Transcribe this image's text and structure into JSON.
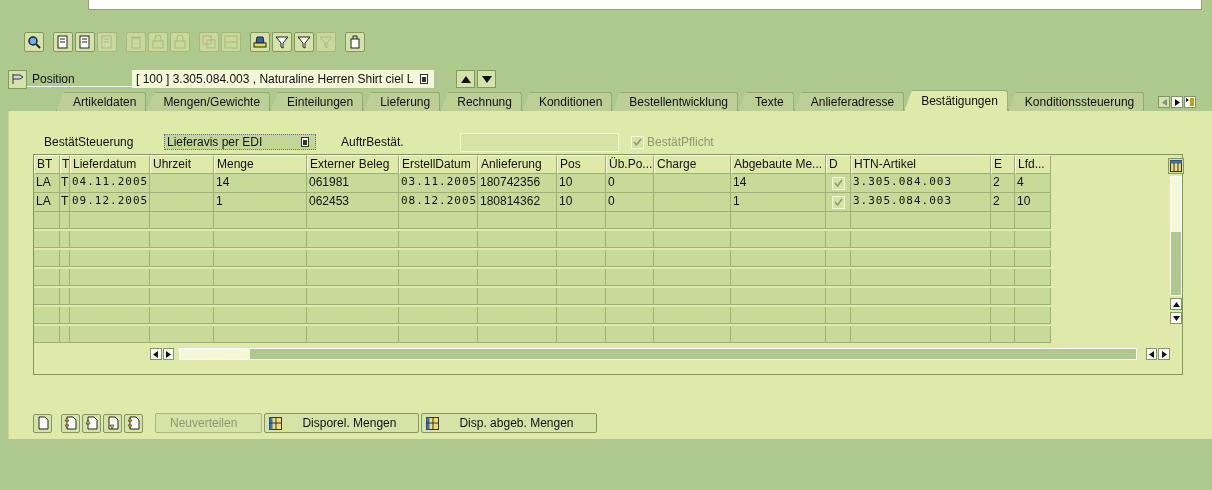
{
  "toolbar": [
    {
      "kind": "search",
      "disabled": false
    },
    {
      "kind": "doc",
      "disabled": false
    },
    {
      "kind": "doc",
      "disabled": false
    },
    {
      "kind": "doc",
      "disabled": true
    },
    {
      "kind": "trash",
      "disabled": true
    },
    {
      "kind": "lock",
      "disabled": true
    },
    {
      "kind": "lock",
      "disabled": true
    },
    {
      "kind": "copy",
      "disabled": true
    },
    {
      "kind": "grid",
      "disabled": true
    },
    {
      "kind": "print",
      "disabled": false
    },
    {
      "kind": "funnel",
      "disabled": false
    },
    {
      "kind": "funnel",
      "disabled": false
    },
    {
      "kind": "funnel",
      "disabled": true
    },
    {
      "kind": "bag",
      "disabled": false
    }
  ],
  "position": {
    "label": "Position",
    "value": "[ 100 ] 3.305.084.003 , Naturaline Herren Shirt ciel L"
  },
  "tabs": [
    {
      "label": "Artikeldaten",
      "selected": false
    },
    {
      "label": "Mengen/Gewichte",
      "selected": false
    },
    {
      "label": "Einteilungen",
      "selected": false
    },
    {
      "label": "Lieferung",
      "selected": false
    },
    {
      "label": "Rechnung",
      "selected": false
    },
    {
      "label": "Konditionen",
      "selected": false
    },
    {
      "label": "Bestellentwicklung",
      "selected": false
    },
    {
      "label": "Texte",
      "selected": false
    },
    {
      "label": "Anlieferadresse",
      "selected": false
    },
    {
      "label": "Bestätigungen",
      "selected": true
    },
    {
      "label": "Konditionssteuerung",
      "selected": false
    }
  ],
  "form": {
    "control_label": "BestätSteuerung",
    "control_value": "Lieferavis per EDI",
    "order_label": "AuftrBestät.",
    "required_label": "BestätPflicht",
    "required_checked": true,
    "required_disabled": true
  },
  "table": {
    "columns": [
      {
        "label": "BT",
        "kind": "text"
      },
      {
        "label": "T",
        "kind": "text"
      },
      {
        "label": "Lieferdatum",
        "kind": "mono"
      },
      {
        "label": "Uhrzeit",
        "kind": "text"
      },
      {
        "label": "Menge",
        "kind": "text"
      },
      {
        "label": "Externer Beleg",
        "kind": "text"
      },
      {
        "label": "ErstellDatum",
        "kind": "mono"
      },
      {
        "label": "Anlieferung",
        "kind": "text"
      },
      {
        "label": "Pos",
        "kind": "text"
      },
      {
        "label": "Üb.Po...",
        "kind": "text"
      },
      {
        "label": "Charge",
        "kind": "text"
      },
      {
        "label": "Abgebaute Me...",
        "kind": "text"
      },
      {
        "label": "D",
        "kind": "check"
      },
      {
        "label": "HTN-Artikel",
        "kind": "mono"
      },
      {
        "label": "E",
        "kind": "text"
      },
      {
        "label": "Lfd...",
        "kind": "text"
      }
    ],
    "rows": [
      {
        "cells": [
          "LA",
          "T",
          "04.11.2005",
          null,
          "14",
          "061981",
          "03.11.2005",
          "180742356",
          "10",
          "0",
          null,
          "14",
          true,
          "3.305.084.003",
          "2",
          "4"
        ]
      },
      {
        "cells": [
          "LA",
          "T",
          "09.12.2005",
          null,
          "1",
          "062453",
          "08.12.2005",
          "180814362",
          "10",
          "0",
          null,
          "1",
          true,
          "3.305.084.003",
          "2",
          "10"
        ]
      }
    ]
  },
  "bottom_icons": [
    {
      "kind": "new"
    },
    {
      "kind": "arrows"
    },
    {
      "kind": "up"
    },
    {
      "kind": "down"
    },
    {
      "kind": "arrows"
    }
  ],
  "buttons": [
    {
      "label": "Neuverteilen",
      "disabled": true,
      "icon": false
    },
    {
      "label": "Disporel. Mengen",
      "disabled": false,
      "icon": true
    },
    {
      "label": "Disp. abgeb. Mengen",
      "disabled": false,
      "icon": true
    }
  ]
}
